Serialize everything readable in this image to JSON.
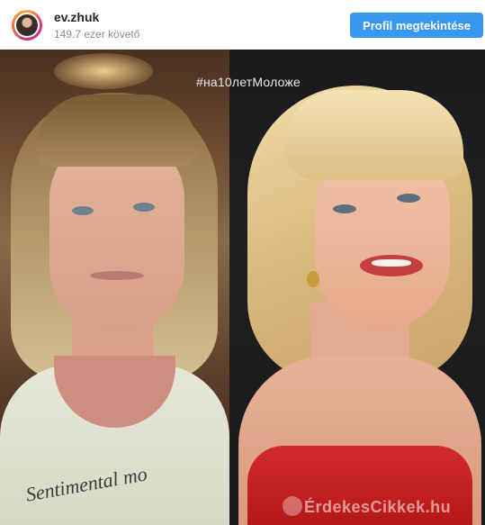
{
  "header": {
    "username": "ev.zhuk",
    "followers": "149.7 ezer követő",
    "profile_button": "Profil megtekintése",
    "button_color": "#3897f0"
  },
  "post": {
    "hashtag": "#на10летМоложе",
    "shirt_text": "Sentimental mo",
    "watermark": "ÉrdekesCikkek.hu",
    "watermark_icon": "leaf-icon"
  }
}
